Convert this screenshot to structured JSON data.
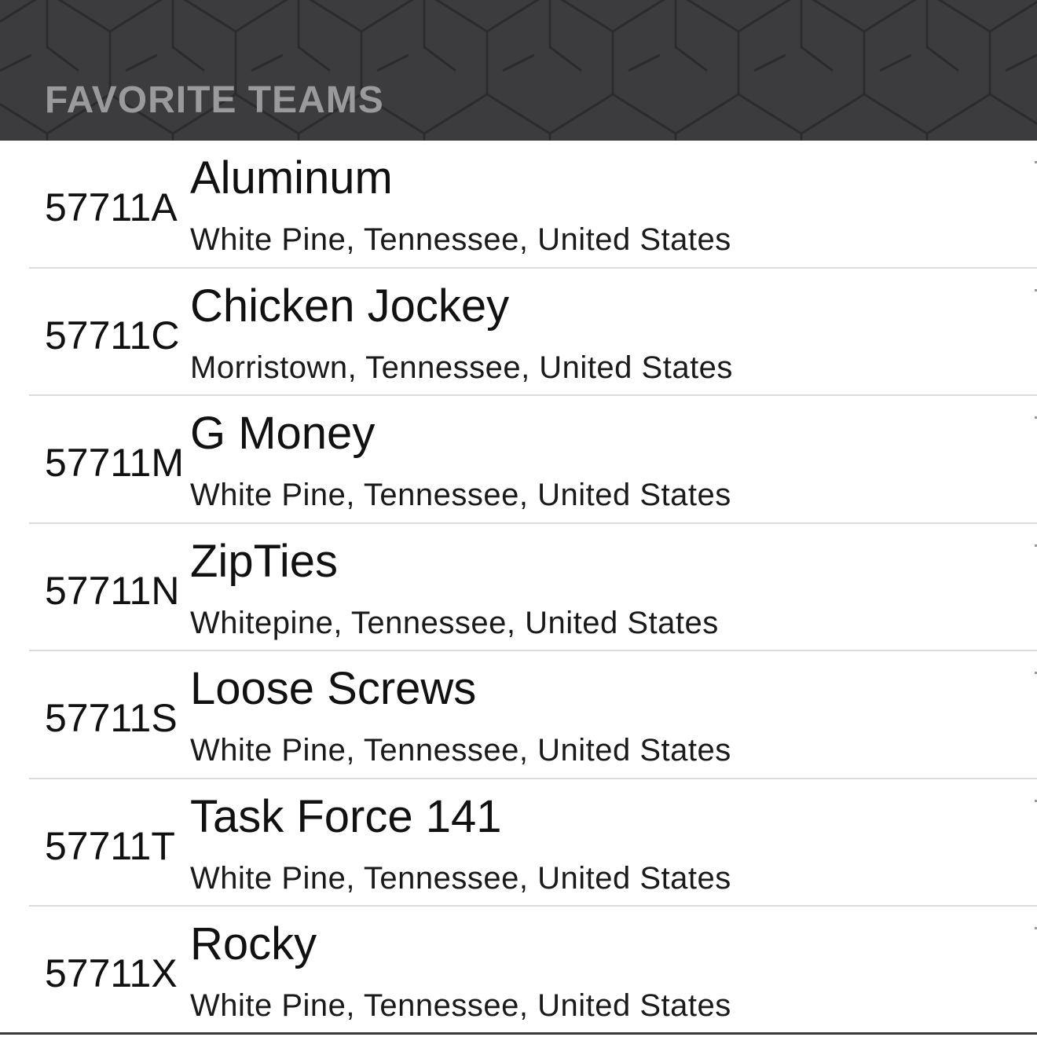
{
  "header": {
    "title": "FAVORITE TEAMS"
  },
  "teams": [
    {
      "number": "57711A",
      "name": "Aluminum",
      "location": "White Pine, Tennessee, United States"
    },
    {
      "number": "57711C",
      "name": "Chicken Jockey",
      "location": "Morristown, Tennessee, United States"
    },
    {
      "number": "57711M",
      "name": "G Money",
      "location": "White Pine, Tennessee, United States"
    },
    {
      "number": "57711N",
      "name": "ZipTies",
      "location": "Whitepine, Tennessee, United States"
    },
    {
      "number": "57711S",
      "name": "Loose Screws",
      "location": "White Pine, Tennessee, United States"
    },
    {
      "number": "57711T",
      "name": "Task Force 141",
      "location": "White Pine, Tennessee, United States"
    },
    {
      "number": "57711X",
      "name": "Rocky",
      "location": "White Pine, Tennessee, United States"
    }
  ],
  "colors": {
    "header_background": "#3c3c3e",
    "header_title": "#9a9a9c",
    "separator": "#dcdcdf"
  }
}
